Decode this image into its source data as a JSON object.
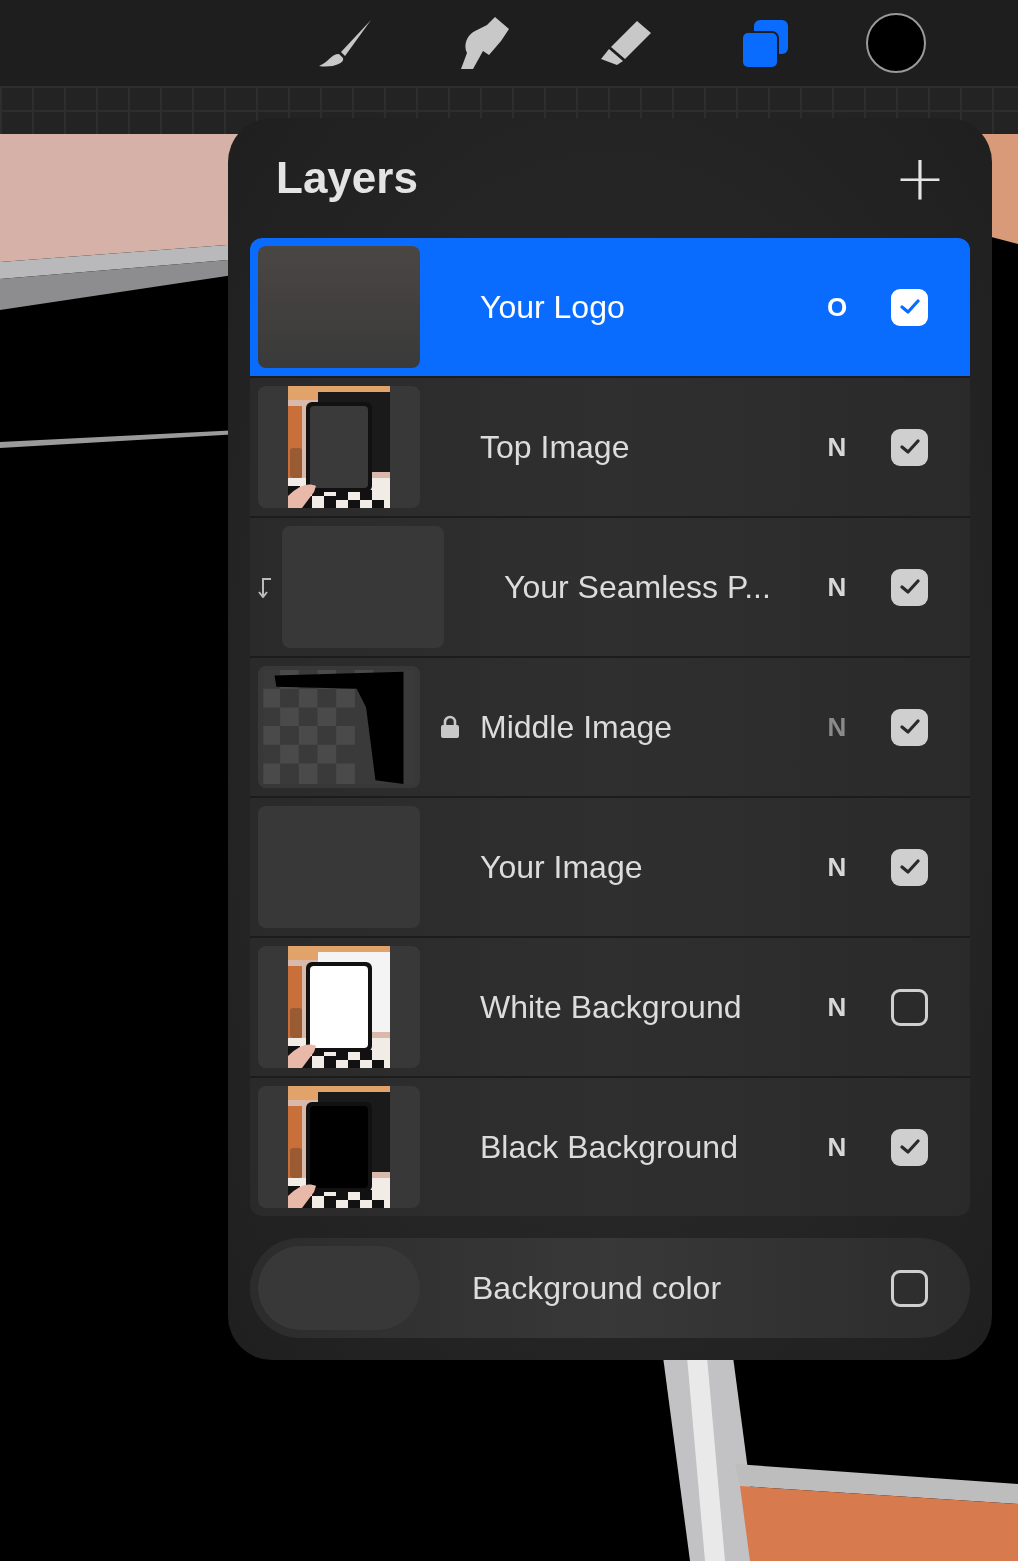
{
  "toolbar": {
    "tools": [
      {
        "kind": "brush",
        "selected": false
      },
      {
        "kind": "smudge",
        "selected": false
      },
      {
        "kind": "eraser",
        "selected": false
      },
      {
        "kind": "layers",
        "selected": true
      }
    ],
    "color": "#000000"
  },
  "canvas": {
    "kind": "artwork"
  },
  "layers_panel": {
    "title": "Layers",
    "add_button": "+",
    "layers": [
      {
        "name": "Your Logo",
        "blend": "O",
        "visible": true,
        "selected": true,
        "locked": false,
        "clipped": false,
        "kind": "blank"
      },
      {
        "name": "Top Image",
        "blend": "N",
        "visible": true,
        "selected": false,
        "locked": false,
        "clipped": false
      },
      {
        "name": "Your Seamless P...",
        "blend": "N",
        "visible": true,
        "selected": false,
        "locked": false,
        "clipped": true,
        "kind": "blank"
      },
      {
        "name": "Middle Image",
        "blend": "N",
        "visible": true,
        "selected": false,
        "locked": true,
        "clipped": false,
        "kind": "mask"
      },
      {
        "name": "Your Image",
        "blend": "N",
        "visible": true,
        "selected": false,
        "locked": false,
        "clipped": false,
        "kind": "blank"
      },
      {
        "name": "White Background",
        "blend": "N",
        "visible": false,
        "selected": false,
        "locked": false,
        "clipped": false,
        "kind": "photo-light"
      },
      {
        "name": "Black Background",
        "blend": "N",
        "visible": true,
        "selected": false,
        "locked": false,
        "clipped": false,
        "kind": "photo-dark"
      }
    ],
    "background": {
      "label": "Background color",
      "visible": false
    }
  }
}
